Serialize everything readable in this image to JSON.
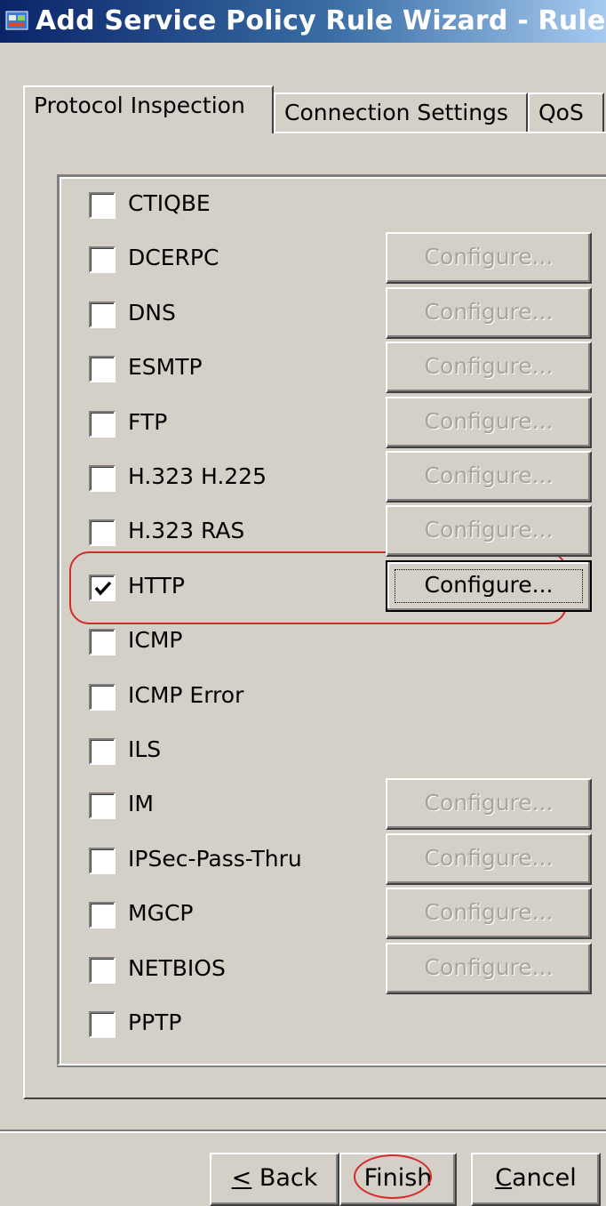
{
  "window": {
    "title": "Add Service Policy Rule Wizard - Rule Acti"
  },
  "tabs": [
    {
      "label": "Protocol Inspection",
      "active": true
    },
    {
      "label": "Connection Settings",
      "active": false
    },
    {
      "label": "QoS",
      "active": false
    }
  ],
  "protocols": [
    {
      "name": "CTIQBE",
      "checked": false,
      "configure": null
    },
    {
      "name": "DCERPC",
      "checked": false,
      "configure": "Configure..."
    },
    {
      "name": "DNS",
      "checked": false,
      "configure": "Configure..."
    },
    {
      "name": "ESMTP",
      "checked": false,
      "configure": "Configure..."
    },
    {
      "name": "FTP",
      "checked": false,
      "configure": "Configure..."
    },
    {
      "name": "H.323 H.225",
      "checked": false,
      "configure": "Configure..."
    },
    {
      "name": "H.323 RAS",
      "checked": false,
      "configure": "Configure..."
    },
    {
      "name": "HTTP",
      "checked": true,
      "configure": "Configure..."
    },
    {
      "name": "ICMP",
      "checked": false,
      "configure": null
    },
    {
      "name": "ICMP Error",
      "checked": false,
      "configure": null
    },
    {
      "name": "ILS",
      "checked": false,
      "configure": null
    },
    {
      "name": "IM",
      "checked": false,
      "configure": "Configure..."
    },
    {
      "name": "IPSec-Pass-Thru",
      "checked": false,
      "configure": "Configure..."
    },
    {
      "name": "MGCP",
      "checked": false,
      "configure": "Configure..."
    },
    {
      "name": "NETBIOS",
      "checked": false,
      "configure": "Configure..."
    },
    {
      "name": "PPTP",
      "checked": false,
      "configure": null
    }
  ],
  "buttons": {
    "back_mnemonic": "<",
    "back_rest": " Back",
    "finish": "Finish",
    "cancel_mnemonic": "C",
    "cancel_rest": "ancel"
  },
  "colors": {
    "title_bar_start": "#0a246a",
    "window_face": "#d4d0c8",
    "annotation_red": "#d42a2a"
  }
}
